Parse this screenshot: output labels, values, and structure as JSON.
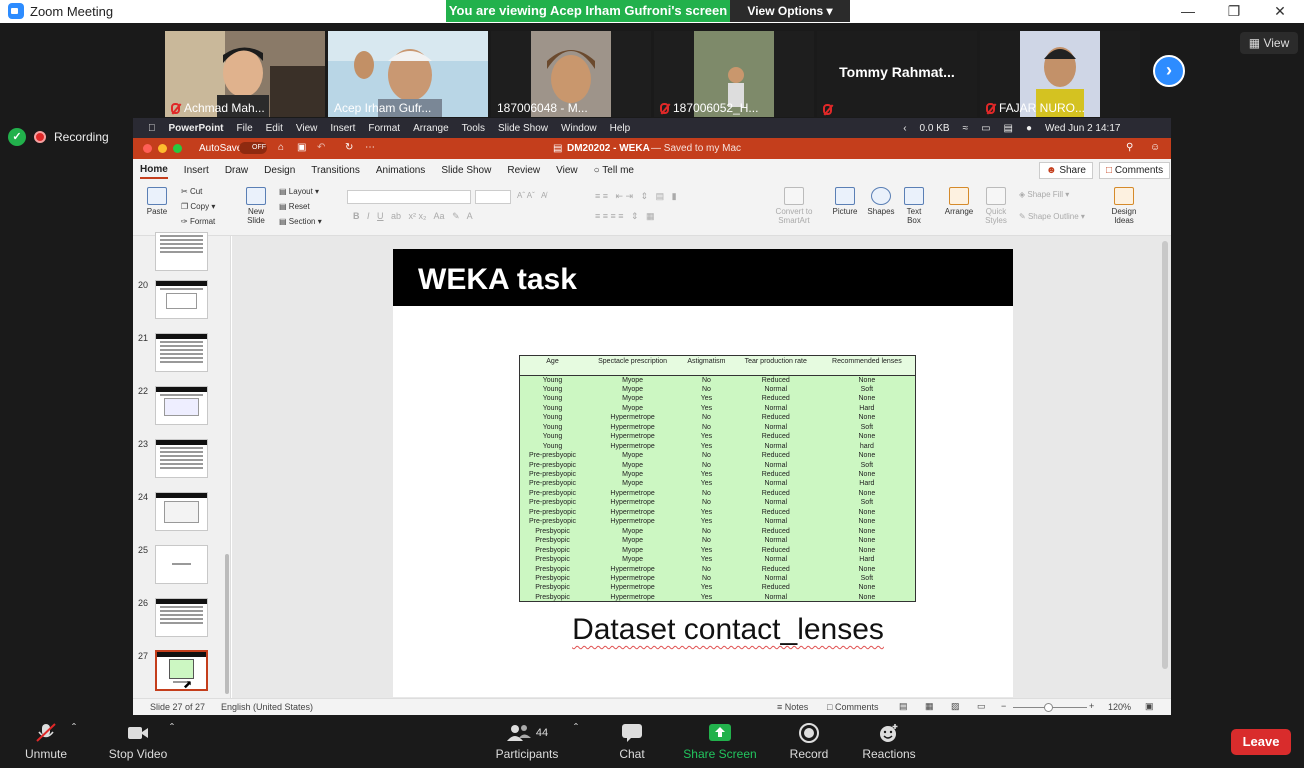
{
  "window": {
    "title": "Zoom Meeting"
  },
  "banner": {
    "viewing": "You are viewing Acep Irham Gufroni's screen",
    "view_options": "View Options"
  },
  "participants_strip": {
    "tiles": [
      {
        "name": "Achmad Mah..."
      },
      {
        "name": "Acep Irham Gufr..."
      },
      {
        "name": "187006048 - M..."
      },
      {
        "name": "187006052_H..."
      },
      {
        "name": "Tommy  Rahmat..."
      },
      {
        "name": "FAJAR NURO..."
      }
    ],
    "view_label": "View"
  },
  "recording": {
    "label": "Recording"
  },
  "mac_menubar": {
    "items": [
      "PowerPoint",
      "File",
      "Edit",
      "View",
      "Insert",
      "Format",
      "Arrange",
      "Tools",
      "Slide Show",
      "Window",
      "Help"
    ],
    "netspeed": "0.0 KB",
    "clock": "Wed Jun 2  14:17"
  },
  "ppt": {
    "autosave": "AutoSave",
    "autosave_state": "OFF",
    "doc_title": "DM20202 - WEKA",
    "doc_saved": "— Saved to my Mac",
    "tabs": [
      "Home",
      "Insert",
      "Draw",
      "Design",
      "Transitions",
      "Animations",
      "Slide Show",
      "Review",
      "View"
    ],
    "tell_me": "Tell me",
    "share": "Share",
    "comments": "Comments",
    "ribbon": {
      "paste": "Paste",
      "cut": "Cut",
      "copy": "Copy",
      "format": "Format",
      "new_slide": "New Slide",
      "layout": "Layout",
      "reset": "Reset",
      "section": "Section",
      "convert": "Convert to SmartArt",
      "picture": "Picture",
      "shapes": "Shapes",
      "text_box": "Text Box",
      "arrange": "Arrange",
      "quick_styles": "Quick Styles",
      "shape_fill": "Shape Fill",
      "shape_outline": "Shape Outline",
      "design_ideas": "Design Ideas"
    },
    "thumb_numbers": [
      "20",
      "21",
      "22",
      "23",
      "24",
      "25",
      "26",
      "27"
    ],
    "slide": {
      "title": "WEKA task",
      "caption": "Dataset contact_lenses",
      "table": {
        "headers": [
          "Age",
          "Spectacle prescription",
          "Astigmatism",
          "Tear production rate",
          "Recommended lenses"
        ],
        "rows": [
          [
            "Young",
            "Myope",
            "No",
            "Reduced",
            "None"
          ],
          [
            "Young",
            "Myope",
            "No",
            "Normal",
            "Soft"
          ],
          [
            "Young",
            "Myope",
            "Yes",
            "Reduced",
            "None"
          ],
          [
            "Young",
            "Myope",
            "Yes",
            "Normal",
            "Hard"
          ],
          [
            "Young",
            "Hypermetrope",
            "No",
            "Reduced",
            "None"
          ],
          [
            "Young",
            "Hypermetrope",
            "No",
            "Normal",
            "Soft"
          ],
          [
            "Young",
            "Hypermetrope",
            "Yes",
            "Reduced",
            "None"
          ],
          [
            "Young",
            "Hypermetrope",
            "Yes",
            "Normal",
            "hard"
          ],
          [
            "Pre-presbyopic",
            "Myope",
            "No",
            "Reduced",
            "None"
          ],
          [
            "Pre-presbyopic",
            "Myope",
            "No",
            "Normal",
            "Soft"
          ],
          [
            "Pre-presbyopic",
            "Myope",
            "Yes",
            "Reduced",
            "None"
          ],
          [
            "Pre-presbyopic",
            "Myope",
            "Yes",
            "Normal",
            "Hard"
          ],
          [
            "Pre-presbyopic",
            "Hypermetrope",
            "No",
            "Reduced",
            "None"
          ],
          [
            "Pre-presbyopic",
            "Hypermetrope",
            "No",
            "Normal",
            "Soft"
          ],
          [
            "Pre-presbyopic",
            "Hypermetrope",
            "Yes",
            "Reduced",
            "None"
          ],
          [
            "Pre-presbyopic",
            "Hypermetrope",
            "Yes",
            "Normal",
            "None"
          ],
          [
            "Presbyopic",
            "Myope",
            "No",
            "Reduced",
            "None"
          ],
          [
            "Presbyopic",
            "Myope",
            "No",
            "Normal",
            "None"
          ],
          [
            "Presbyopic",
            "Myope",
            "Yes",
            "Reduced",
            "None"
          ],
          [
            "Presbyopic",
            "Myope",
            "Yes",
            "Normal",
            "Hard"
          ],
          [
            "Presbyopic",
            "Hypermetrope",
            "No",
            "Reduced",
            "None"
          ],
          [
            "Presbyopic",
            "Hypermetrope",
            "No",
            "Normal",
            "Soft"
          ],
          [
            "Presbyopic",
            "Hypermetrope",
            "Yes",
            "Reduced",
            "None"
          ],
          [
            "Presbyopic",
            "Hypermetrope",
            "Yes",
            "Normal",
            "None"
          ]
        ]
      }
    },
    "status": {
      "slide_of": "Slide 27 of 27",
      "language": "English (United States)",
      "notes": "Notes",
      "comments": "Comments",
      "zoom": "120%"
    }
  },
  "toolbar": {
    "unmute": "Unmute",
    "stop_video": "Stop Video",
    "participants": "Participants",
    "participants_count": "44",
    "chat": "Chat",
    "share_screen": "Share Screen",
    "record": "Record",
    "reactions": "Reactions",
    "leave": "Leave"
  },
  "colors": {
    "zoom_blue": "#2d8cff",
    "share_green": "#22b14c",
    "ppt_red": "#c43e1c",
    "leave_red": "#d92c2c",
    "table_green": "#ccf7c2"
  }
}
